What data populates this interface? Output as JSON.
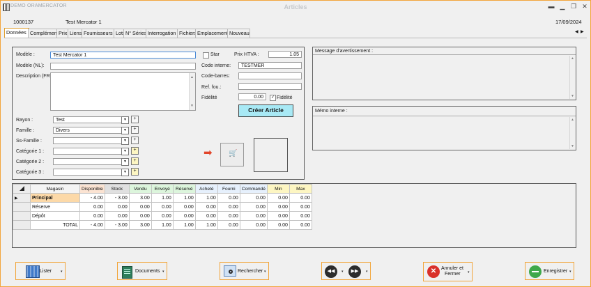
{
  "window": {
    "app_name": "DEMO ORAMERCATOR",
    "title": "Articles"
  },
  "header": {
    "code": "1000137",
    "name": "Test Mercator 1",
    "date": "17/09/2024"
  },
  "tabs": [
    {
      "label": "Données",
      "active": true
    },
    {
      "label": "Complément"
    },
    {
      "label": "Prix"
    },
    {
      "label": "Liens"
    },
    {
      "label": "Fournisseurs"
    },
    {
      "label": "Lots"
    },
    {
      "label": "N° Séries"
    },
    {
      "label": "Interrogation"
    },
    {
      "label": "Fichiers"
    },
    {
      "label": "Emplacements"
    },
    {
      "label": "Nouveau"
    }
  ],
  "form": {
    "modele_label": "Modèle :",
    "modele_value": "Test Mercator 1",
    "modele_nl_label": "Modèle (NL):",
    "modele_nl_value": "",
    "description_label": "Description (FR...",
    "rayon_label": "Rayon :",
    "rayon_value": "Test",
    "famille_label": "Famille :",
    "famille_value": "Divers",
    "ssfamille_label": "Ss-Famille :",
    "ssfamille_value": "",
    "categorie1_label": "Catégorie 1 :",
    "categorie2_label": "Catégorie 2 :",
    "categorie3_label": "Catégorie 3 :",
    "star_label": "Star",
    "prix_label": "Prix HTVA :",
    "prix_value": "1.05",
    "code_interne_label": "Code interne:",
    "code_interne_value": "TESTMER",
    "code_barres_label": "Code-barres:",
    "ref_fou_label": "Ref. fou.:",
    "fidelite_label": "Fidélité",
    "fidelite_value": "0.00",
    "fidelite_chk_label": "Fidélité",
    "create_button": "Créer Article"
  },
  "right_panel": {
    "warning_label": "Message d'avertissement :",
    "memo_label": "Mémo interne :"
  },
  "grid": {
    "columns": [
      "Magasin",
      "Disponible",
      "Stock",
      "Vendu",
      "Envoyé",
      "Réservé",
      "Acheté",
      "Fourni",
      "Commandé",
      "Min",
      "Max"
    ],
    "rows": [
      {
        "magasin": "Principal",
        "values": [
          "- 4.00",
          "- 3.00",
          "3.00",
          "1.00",
          "1.00",
          "1.00",
          "0.00",
          "0.00",
          "0.00",
          "0.00"
        ]
      },
      {
        "magasin": "Réserve",
        "values": [
          "0.00",
          "0.00",
          "0.00",
          "0.00",
          "0.00",
          "0.00",
          "0.00",
          "0.00",
          "0.00",
          "0.00"
        ]
      },
      {
        "magasin": "Dépôt",
        "values": [
          "0.00",
          "0.00",
          "0.00",
          "0.00",
          "0.00",
          "0.00",
          "0.00",
          "0.00",
          "0.00",
          "0.00"
        ]
      },
      {
        "magasin": "TOTAL",
        "values": [
          "- 4.00",
          "- 3.00",
          "3.00",
          "1.00",
          "1.00",
          "1.00",
          "0.00",
          "0.00",
          "0.00",
          "0.00"
        ]
      }
    ]
  },
  "toolbar": {
    "lister": "Lister",
    "documents": "Documents",
    "rechercher": "Rechercher",
    "annuler_line1": "Annuler et",
    "annuler_line2": "Fermer",
    "enregistrer": "Enregistrer"
  }
}
